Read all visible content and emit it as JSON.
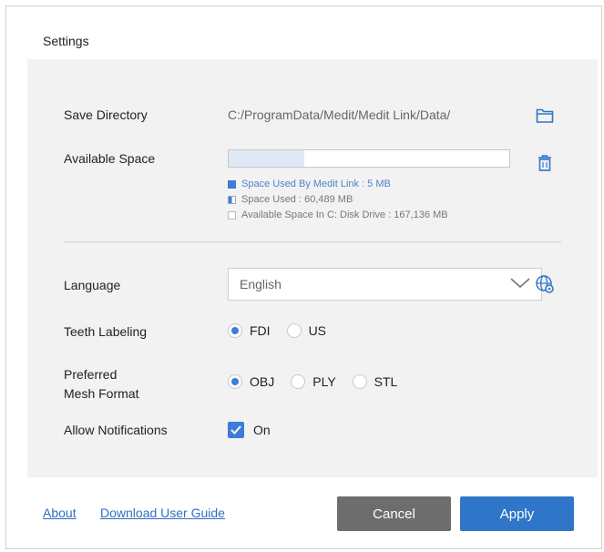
{
  "window": {
    "title": "Settings"
  },
  "save_directory": {
    "label": "Save Directory",
    "path": "C:/ProgramData/Medit/Medit Link/Data/"
  },
  "available_space": {
    "label": "Available Space",
    "used_by_medit_fraction": 0.27,
    "legend": {
      "medit": "Space Used By Medit Link : 5 MB",
      "used": "Space Used : 60,489 MB",
      "available": "Available Space In C: Disk Drive : 167,136 MB"
    }
  },
  "language": {
    "label": "Language",
    "value": "English"
  },
  "teeth_labeling": {
    "label": "Teeth Labeling",
    "options": [
      "FDI",
      "US"
    ],
    "selected": "FDI"
  },
  "mesh_format": {
    "label_line1": "Preferred",
    "label_line2": "Mesh Format",
    "options": [
      "OBJ",
      "PLY",
      "STL"
    ],
    "selected": "OBJ"
  },
  "notifications": {
    "label": "Allow Notifications",
    "checkbox_label": "On",
    "checked": true
  },
  "footer": {
    "about": "About",
    "guide": "Download User Guide",
    "cancel": "Cancel",
    "apply": "Apply"
  },
  "colors": {
    "accent": "#2f76c8",
    "cancel": "#6d6d6d",
    "panel": "#f2f2f2"
  }
}
